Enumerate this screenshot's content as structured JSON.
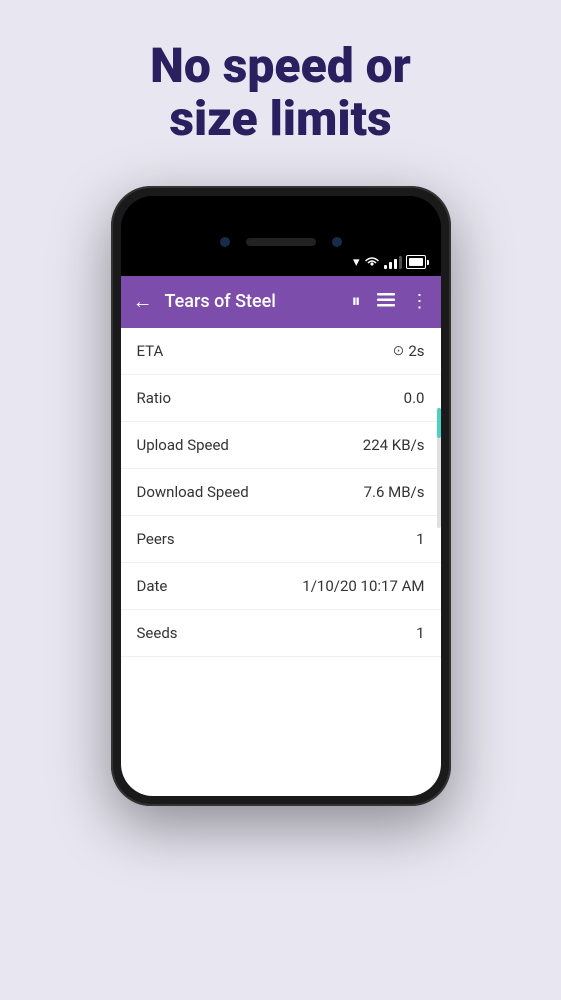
{
  "page": {
    "background_color": "#e8e6f0"
  },
  "headline": {
    "line1": "No speed or",
    "line2": "size limits"
  },
  "appbar": {
    "title": "Tears of Steel",
    "back_label": "←",
    "pause_label": "⏸",
    "list_label": "≡",
    "more_label": "⋮"
  },
  "rows": [
    {
      "label": "ETA",
      "value": "2s",
      "has_icon": true
    },
    {
      "label": "Ratio",
      "value": "0.0",
      "has_icon": false
    },
    {
      "label": "Upload Speed",
      "value": "224 KB/s",
      "has_icon": false
    },
    {
      "label": "Download Speed",
      "value": "7.6 MB/s",
      "has_icon": false
    },
    {
      "label": "Peers",
      "value": "1",
      "has_icon": false
    },
    {
      "label": "Date",
      "value": "1/10/20 10:17 AM",
      "has_icon": false
    },
    {
      "label": "Seeds",
      "value": "1",
      "has_icon": false
    }
  ],
  "colors": {
    "accent": "#7c4daa",
    "headline": "#2a2060",
    "background": "#e8e6f0"
  }
}
